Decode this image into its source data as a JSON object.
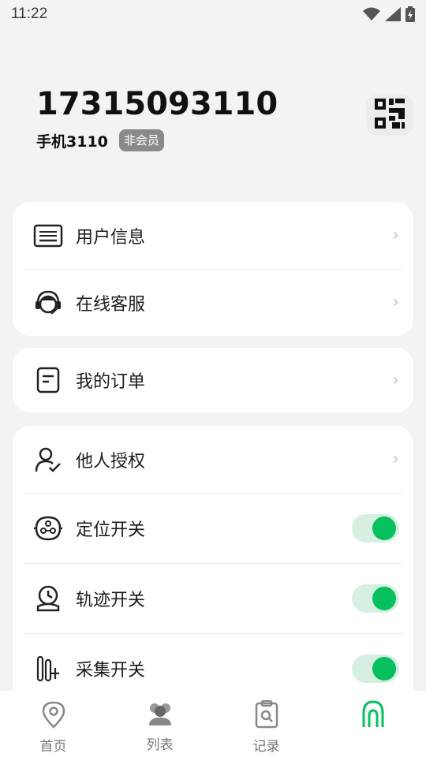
{
  "status_bar": {
    "time": "11:22"
  },
  "profile": {
    "phone_number": "17315093110",
    "device_name": "手机3110",
    "member_status": "非会员"
  },
  "menu_group_1": [
    {
      "label": "用户信息",
      "icon": "keyboard-icon"
    },
    {
      "label": "在线客服",
      "icon": "headset-icon"
    }
  ],
  "menu_group_2": [
    {
      "label": "我的订单",
      "icon": "order-icon"
    }
  ],
  "menu_group_3": [
    {
      "label": "他人授权",
      "icon": "user-check-icon"
    },
    {
      "label": "定位开关",
      "icon": "location-switch-icon",
      "toggle_on": true
    },
    {
      "label": "轨迹开关",
      "icon": "track-icon",
      "toggle_on": true
    },
    {
      "label": "采集开关",
      "icon": "collect-icon",
      "toggle_on": true
    }
  ],
  "bottom_nav": [
    {
      "label": "首页",
      "icon": "location-pin-icon"
    },
    {
      "label": "列表",
      "icon": "people-icon"
    },
    {
      "label": "记录",
      "icon": "record-icon"
    },
    {
      "label": "",
      "icon": "profile-tab-icon",
      "active": true
    }
  ],
  "colors": {
    "accent": "#06c060",
    "toggle_track": "#d6efe1",
    "badge": "#8a8a8a"
  }
}
